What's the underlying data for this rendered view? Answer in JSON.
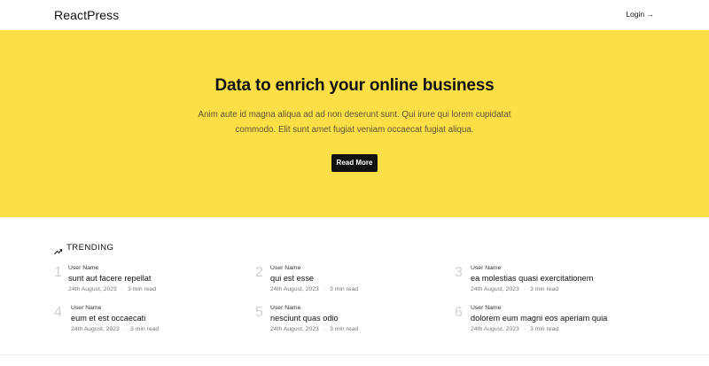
{
  "nav": {
    "brand": "ReactPress",
    "login_label": "Login →"
  },
  "hero": {
    "title": "Data to enrich your online business",
    "text": "Anim aute id magna aliqua ad ad non deserunt sunt. Qui irure qui lorem cupidatat commodo. Elit sunt amet fugiat veniam occaecat fugiat aliqua.",
    "button_label": "Read More",
    "background_color": "#fcde47"
  },
  "trending": {
    "heading": "TRENDING",
    "icon": "trending-up-icon",
    "items": [
      {
        "number": "1",
        "author": "User Name",
        "title": "sunt aut facere repellat",
        "date": "24th August, 2023",
        "read_time": "3 min read"
      },
      {
        "number": "2",
        "author": "User Name",
        "title": "qui est esse",
        "date": "24th August, 2023",
        "read_time": "3 min read"
      },
      {
        "number": "3",
        "author": "User Name",
        "title": "ea molestias quasi exercitationem",
        "date": "24th August, 2023",
        "read_time": "3 min read"
      },
      {
        "number": "4",
        "author": "User Name",
        "title": "eum et est occaecati",
        "date": "24th August, 2023",
        "read_time": "3 min read"
      },
      {
        "number": "5",
        "author": "User Name",
        "title": "nesciunt quas odio",
        "date": "24th August, 2023",
        "read_time": "3 min read"
      },
      {
        "number": "6",
        "author": "User Name",
        "title": "dolorem eum magni eos aperiam quia",
        "date": "24th August, 2023",
        "read_time": "3 min read"
      }
    ],
    "separator": "·"
  }
}
